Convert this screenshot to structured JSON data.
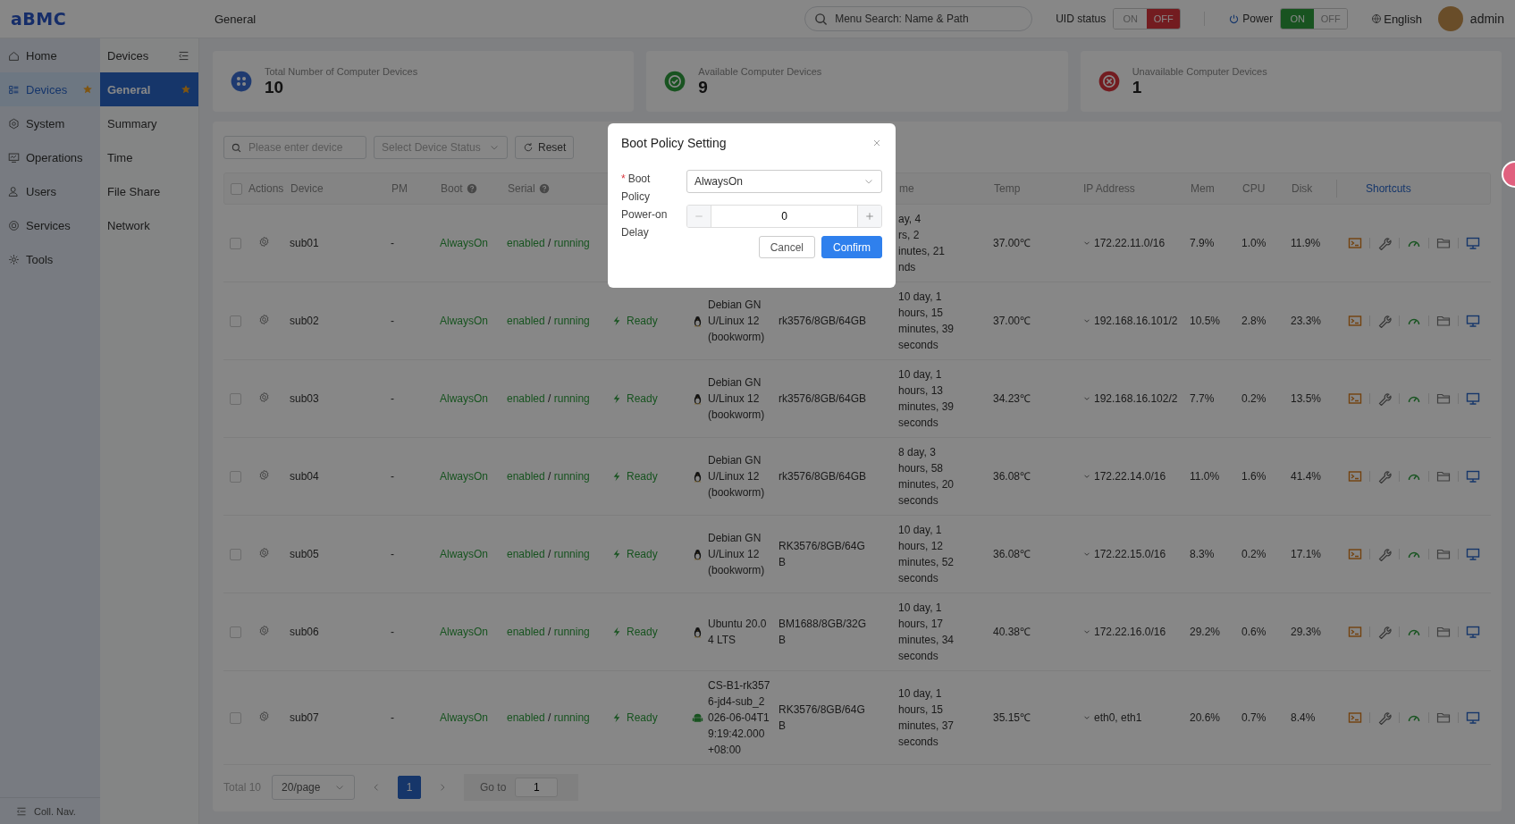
{
  "topbar": {
    "logo": "aBMC",
    "page_title": "General",
    "search": {
      "placeholder": "Menu Search: Name & Path"
    },
    "uid_status": {
      "label": "UID status",
      "options": [
        {
          "label": "ON",
          "selected": false
        },
        {
          "label": "OFF",
          "selected": true
        }
      ]
    },
    "power": {
      "label": "Power",
      "options": [
        {
          "label": "ON",
          "selected": true
        },
        {
          "label": "OFF",
          "selected": false
        }
      ]
    },
    "language": "English",
    "user": "admin"
  },
  "nav": {
    "items": [
      {
        "label": "Home",
        "selected": false,
        "starred": false
      },
      {
        "label": "Devices",
        "selected": true,
        "starred": true
      },
      {
        "label": "System",
        "selected": false,
        "starred": false
      },
      {
        "label": "Operations",
        "selected": false,
        "starred": false
      },
      {
        "label": "Users",
        "selected": false,
        "starred": false
      },
      {
        "label": "Services",
        "selected": false,
        "starred": false
      },
      {
        "label": "Tools",
        "selected": false,
        "starred": false
      }
    ],
    "collapse": "Coll. Nav."
  },
  "subnav": {
    "title": "Devices",
    "items": [
      {
        "label": "General",
        "selected": true,
        "starred": true
      },
      {
        "label": "Summary",
        "selected": false,
        "starred": false
      },
      {
        "label": "Time",
        "selected": false,
        "starred": false
      },
      {
        "label": "File Share",
        "selected": false,
        "starred": false
      },
      {
        "label": "Network",
        "selected": false,
        "starred": false
      }
    ]
  },
  "stats": [
    {
      "label": "Total Number of Computer Devices",
      "value": "10",
      "kind": "total"
    },
    {
      "label": "Available Computer Devices",
      "value": "9",
      "kind": "available"
    },
    {
      "label": "Unavailable Computer Devices",
      "value": "1",
      "kind": "unavailable"
    }
  ],
  "filters": {
    "search": {
      "placeholder": "Please enter device"
    },
    "status_select": {
      "placeholder": "Select Device Status"
    },
    "reset": "Reset"
  },
  "table": {
    "select_all_checked": false,
    "columns": [
      {
        "label": "Actions",
        "kind": "plain"
      },
      {
        "label": "Device",
        "kind": "plain"
      },
      {
        "label": "PM",
        "kind": "plain"
      },
      {
        "label": "Boot",
        "kind": "help"
      },
      {
        "label": "Serial",
        "kind": "help"
      },
      null,
      null,
      null,
      {
        "label": "me",
        "kind": "plain"
      },
      {
        "label": "Temp",
        "kind": "plain"
      },
      {
        "label": "IP Address",
        "kind": "plain"
      },
      {
        "label": "Mem",
        "kind": "plain"
      },
      {
        "label": "CPU",
        "kind": "plain"
      },
      {
        "label": "Disk",
        "kind": "plain"
      },
      {
        "label": "Shortcuts",
        "kind": "plain"
      }
    ],
    "rows": [
      {
        "checked": false,
        "device": "sub01",
        "pm": "-",
        "boot": "AlwaysOn",
        "serial": [
          "enabled",
          "/",
          "running"
        ],
        "uptime": [
          "ay, 4",
          "rs, 2",
          "inutes, 21",
          "nds"
        ],
        "temp": "37.00℃",
        "ip": "172.22.11.0/16",
        "mem": "7.9%",
        "cpu": "1.0%",
        "disk": "11.9%"
      },
      {
        "checked": false,
        "device": "sub02",
        "pm": "-",
        "boot": "AlwaysOn",
        "serial": [
          "enabled",
          "/",
          "running"
        ],
        "status": "Ready",
        "os": {
          "kind": "linux",
          "lines": [
            "Debian GN",
            "U/Linux 12",
            "(bookworm)"
          ]
        },
        "hardware": [
          "rk3576/8GB/64GB"
        ],
        "uptime": [
          "10 day, 1",
          "hours, 15",
          "minutes, 39",
          "seconds"
        ],
        "temp": "37.00℃",
        "ip": "192.168.16.101/2",
        "mem": "10.5%",
        "cpu": "2.8%",
        "disk": "23.3%"
      },
      {
        "checked": false,
        "device": "sub03",
        "pm": "-",
        "boot": "AlwaysOn",
        "serial": [
          "enabled",
          "/",
          "running"
        ],
        "status": "Ready",
        "os": {
          "kind": "linux",
          "lines": [
            "Debian GN",
            "U/Linux 12",
            "(bookworm)"
          ]
        },
        "hardware": [
          "rk3576/8GB/64GB"
        ],
        "uptime": [
          "10 day, 1",
          "hours, 13",
          "minutes, 39",
          "seconds"
        ],
        "temp": "34.23℃",
        "ip": "192.168.16.102/2",
        "mem": "7.7%",
        "cpu": "0.2%",
        "disk": "13.5%"
      },
      {
        "checked": false,
        "device": "sub04",
        "pm": "-",
        "boot": "AlwaysOn",
        "serial": [
          "enabled",
          "/",
          "running"
        ],
        "status": "Ready",
        "os": {
          "kind": "linux",
          "lines": [
            "Debian GN",
            "U/Linux 12",
            "(bookworm)"
          ]
        },
        "hardware": [
          "rk3576/8GB/64GB"
        ],
        "uptime": [
          "8 day, 3",
          "hours, 58",
          "minutes, 20",
          "seconds"
        ],
        "temp": "36.08℃",
        "ip": "172.22.14.0/16",
        "mem": "11.0%",
        "cpu": "1.6%",
        "disk": "41.4%"
      },
      {
        "checked": false,
        "device": "sub05",
        "pm": "-",
        "boot": "AlwaysOn",
        "serial": [
          "enabled",
          "/",
          "running"
        ],
        "status": "Ready",
        "os": {
          "kind": "linux",
          "lines": [
            "Debian GN",
            "U/Linux 12",
            "(bookworm)"
          ]
        },
        "hardware": [
          "RK3576/8GB/64G",
          "B"
        ],
        "uptime": [
          "10 day, 1",
          "hours, 12",
          "minutes, 52",
          "seconds"
        ],
        "temp": "36.08℃",
        "ip": "172.22.15.0/16",
        "mem": "8.3%",
        "cpu": "0.2%",
        "disk": "17.1%"
      },
      {
        "checked": false,
        "device": "sub06",
        "pm": "-",
        "boot": "AlwaysOn",
        "serial": [
          "enabled",
          "/",
          "running"
        ],
        "status": "Ready",
        "os": {
          "kind": "linux",
          "lines": [
            "Ubuntu 20.0",
            "4 LTS"
          ]
        },
        "hardware": [
          "BM1688/8GB/32G",
          "B"
        ],
        "uptime": [
          "10 day, 1",
          "hours, 17",
          "minutes, 34",
          "seconds"
        ],
        "temp": "40.38℃",
        "ip": "172.22.16.0/16",
        "mem": "29.2%",
        "cpu": "0.6%",
        "disk": "29.3%"
      },
      {
        "checked": false,
        "device": "sub07",
        "pm": "-",
        "boot": "AlwaysOn",
        "serial": [
          "enabled",
          "/",
          "running"
        ],
        "status": "Ready",
        "os": {
          "kind": "android",
          "lines": [
            "CS-B1-rk357",
            "6-jd4-sub_2",
            "026-06-04T1",
            "9:19:42.000",
            "+08:00"
          ]
        },
        "hardware": [
          "RK3576/8GB/64G",
          "B"
        ],
        "uptime": [
          "10 day, 1",
          "hours, 15",
          "minutes, 37",
          "seconds"
        ],
        "temp": "35.15℃",
        "ip": "eth0, eth1",
        "mem": "20.6%",
        "cpu": "0.7%",
        "disk": "8.4%"
      }
    ]
  },
  "pagination": {
    "total": "Total 10",
    "page_size": "20/page",
    "pages": [
      {
        "label": "1",
        "selected": true
      }
    ],
    "goto_label": "Go to",
    "goto_value": "1"
  },
  "dialog": {
    "title": "Boot Policy Setting",
    "fields": [
      {
        "kind": "select",
        "required_mark": "*",
        "label": "Boot Policy",
        "value": "AlwaysOn"
      },
      {
        "kind": "stepper",
        "label": "Power-on Delay",
        "value": "0"
      }
    ],
    "buttons": [
      {
        "label": "Cancel",
        "kind": "secondary"
      },
      {
        "label": "Confirm",
        "kind": "primary"
      }
    ]
  }
}
